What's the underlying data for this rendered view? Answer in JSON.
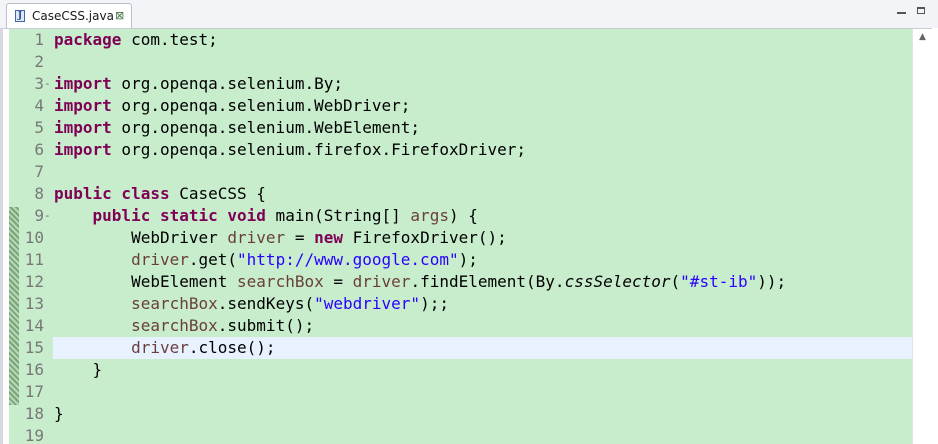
{
  "tab": {
    "title": "CaseCSS.java",
    "file_icon": "java-file-icon",
    "close_icon": "close-icon"
  },
  "window_controls": {
    "minimize_icon": "minimize-icon",
    "maximize_icon": "maximize-icon"
  },
  "editor": {
    "background": "#c7edcc",
    "current_line_background": "#e8f2fe",
    "current_line_number": 15,
    "lines": [
      {
        "n": "1",
        "fold": ""
      },
      {
        "n": "2",
        "fold": ""
      },
      {
        "n": "3",
        "fold": "-"
      },
      {
        "n": "4",
        "fold": ""
      },
      {
        "n": "5",
        "fold": ""
      },
      {
        "n": "6",
        "fold": ""
      },
      {
        "n": "7",
        "fold": ""
      },
      {
        "n": "8",
        "fold": ""
      },
      {
        "n": "9",
        "fold": "-"
      },
      {
        "n": "10",
        "fold": ""
      },
      {
        "n": "11",
        "fold": ""
      },
      {
        "n": "12",
        "fold": ""
      },
      {
        "n": "13",
        "fold": ""
      },
      {
        "n": "14",
        "fold": ""
      },
      {
        "n": "15",
        "fold": ""
      },
      {
        "n": "16",
        "fold": ""
      },
      {
        "n": "17",
        "fold": ""
      },
      {
        "n": "18",
        "fold": ""
      },
      {
        "n": "19",
        "fold": ""
      }
    ],
    "code": {
      "l1_kw": "package",
      "l1_rest": " com.test;",
      "import_kw": "import",
      "l3_rest": " org.openqa.selenium.By;",
      "l4_rest": " org.openqa.selenium.WebDriver;",
      "l5_rest": " org.openqa.selenium.WebElement;",
      "l6_rest": " org.openqa.selenium.firefox.FirefoxDriver;",
      "l8_kw": "public class",
      "l8_rest": " CaseCSS {",
      "l9_indent": "    ",
      "l9_kw": "public static void",
      "l9_mid": " main(String[] ",
      "l9_var": "args",
      "l9_end": ") {",
      "l10_indent": "        ",
      "l10_a": "WebDriver ",
      "l10_var": "driver",
      "l10_b": " = ",
      "l10_kw": "new",
      "l10_c": " FirefoxDriver();",
      "l11_indent": "        ",
      "l11_var": "driver",
      "l11_a": ".get(",
      "l11_str": "\"http://www.google.com\"",
      "l11_b": ");",
      "l12_indent": "        ",
      "l12_a": "WebElement ",
      "l12_var": "searchBox",
      "l12_b": " = ",
      "l12_var2": "driver",
      "l12_c": ".findElement(By.",
      "l12_ital": "cssSelector",
      "l12_d": "(",
      "l12_str": "\"#st-ib\"",
      "l12_e": "));",
      "l13_indent": "        ",
      "l13_var": "searchBox",
      "l13_a": ".sendKeys(",
      "l13_str": "\"webdriver\"",
      "l13_b": ");;",
      "l14_indent": "        ",
      "l14_var": "searchBox",
      "l14_a": ".submit();",
      "l15_indent": "        ",
      "l15_var": "driver",
      "l15_a": ".close();",
      "l16": "    }",
      "l18": "}"
    }
  },
  "scrollbar": {
    "up_icon": "scroll-up-arrow-icon"
  }
}
